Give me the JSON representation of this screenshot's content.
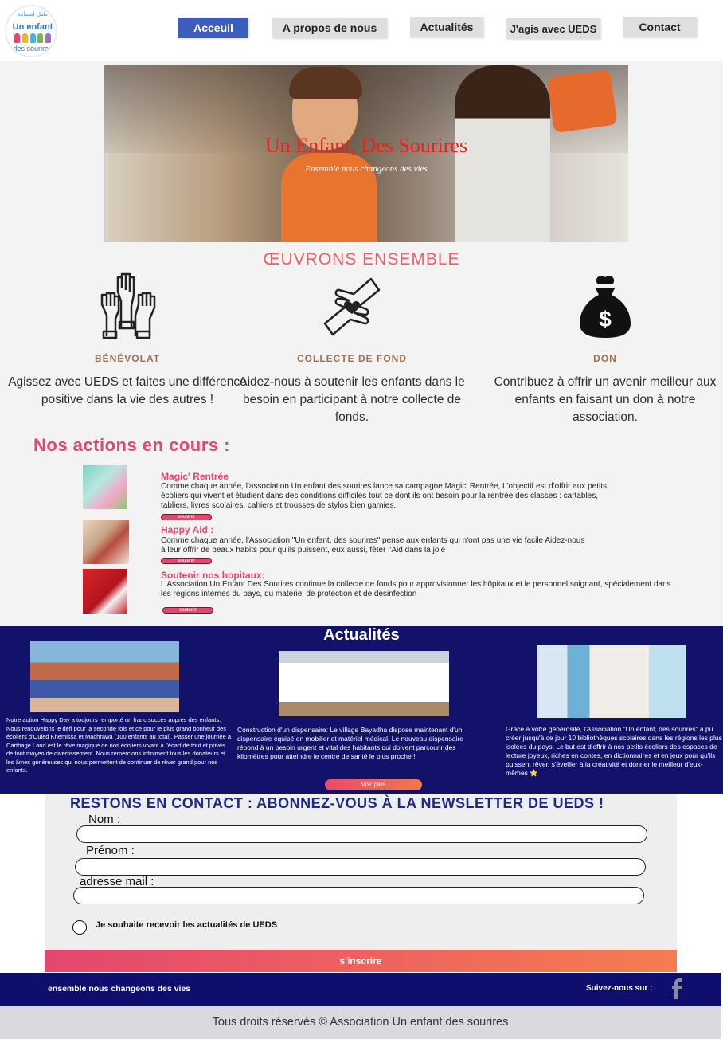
{
  "header": {
    "logo": {
      "arabic_text": "طفل ابتسامة",
      "line1": "Un enfant",
      "line2": "des sourires",
      "kid_colors": [
        "#e8466e",
        "#f2b233",
        "#4bb3e0",
        "#7ab648",
        "#a56bc9"
      ]
    },
    "nav": [
      {
        "label": "Acceuil",
        "active": true
      },
      {
        "label": "A propos de nous",
        "active": false
      },
      {
        "label": "Actualités",
        "active": false
      },
      {
        "label": "J'agis avec UEDS",
        "active": false
      },
      {
        "label": "Contact",
        "active": false
      }
    ]
  },
  "hero": {
    "title": "Un Enfant, Des Sourires",
    "subtitle": "Ensemble nous changeons des vies"
  },
  "section_title": "ŒUVRONS ENSEMBLE",
  "features": [
    {
      "icon": "raised-hands-icon",
      "label": "BÉNÉVOLAT",
      "text": "Agissez avec UEDS et faites une différence positive dans la vie des autres !"
    },
    {
      "icon": "hand-heart-icon",
      "label": "COLLECTE DE FOND",
      "text": "Aidez-nous à soutenir les enfants dans le besoin en participant à notre collecte de fonds."
    },
    {
      "icon": "money-bag-icon",
      "label": "DON",
      "text": "Contribuez à offrir un avenir meilleur aux enfants en faisant un don à notre association."
    }
  ],
  "actions": {
    "title": "Nos actions en cours :",
    "button_label": "soutenir",
    "items": [
      {
        "title": "Magic' Rentrée",
        "text": "Comme chaque année, l'association Un enfant des sourires lance sa campagne Magic' Rentrée, L'objectif est d'offrir aux petits écoliers qui vivent et étudient dans des conditions difficiles tout ce dont ils ont besoin pour la rentrée des classes : cartables, tabliers, livres scolaires, cahiers et trousses de stylos bien garnies."
      },
      {
        "title": "Happy Aid :",
        "text": "Comme chaque année, l'Association \"Un enfant, des sourires\" pense aux enfants qui n'ont pas une vie facile Aidez-nous à leur offrir de beaux habits pour qu'ils puissent, eux aussi, fêter l'Aid dans la joie"
      },
      {
        "title": "Soutenir nos hopitaux:",
        "text": "L'Association Un Enfant Des Sourires continue la collecte de fonds pour approvisionner les hôpitaux et le personnel soignant, spécialement dans les régions internes du pays, du matériel de protection et de désinfection"
      }
    ]
  },
  "news": {
    "title": "Actualités",
    "items": [
      {
        "text": "Notre action Happy Day a toujours remporté un franc succès auprès des enfants. Nous renouvelons le défi pour la seconde fois et ce pour le plus grand bonheur des écoliers d'Ouled Khemissa et Machrawa (100 enfants au total). Passer une journée à Carthage Land est le rêve magique de nos écoliers vivant à l'écart de tout et privés de tout moyen de divertissement. Nous remercions infiniment tous les donateurs et les âmes généreuses qui nous permettent de continuer de rêver grand pour nos enfants."
      },
      {
        "text": "Construction d'un dispensaire: Le village Bayadha dispose maintenant d'un dispensaire équipé en mobilier et matériel médical. Le nouveau dispensaire répond à un besoin urgent et vital des habitants qui doivent parcourir des kilomètres pour atteindre le centre de santé le plus proche !"
      },
      {
        "text": "Grâce à votre générosité, l'Association \"Un enfant, des sourires\" a pu créer jusqu'à ce jour 10 bibliothèques scolaires dans les régions les plus isolées du pays. Le but est d'offrir à nos petits écoliers des espaces de lecture joyeux, riches en contes, en dictionnaires et en jeux pour qu'ils puissent rêver, s'éveiller à la créativité et donner le meilleur d'eux-mêmes ⭐"
      }
    ],
    "more_label": "Voir plus"
  },
  "newsletter": {
    "title": "RESTONS EN CONTACT : ABONNEZ-VOUS À LA NEWSLETTER DE UEDS !",
    "fields": [
      {
        "label": "Nom :",
        "value": ""
      },
      {
        "label": "Prénom :",
        "value": ""
      },
      {
        "label": "adresse mail :",
        "value": ""
      }
    ],
    "checkbox_label": "Je souhaite recevoir les actualités de UEDS",
    "submit_label": "s'inscrire"
  },
  "footer": {
    "tagline": "ensemble nous changeons des vies",
    "follow": "Suivez-nous sur :",
    "social_icon": "facebook-icon",
    "copyright": "Tous droits réservés © Association Un enfant,des sourires"
  }
}
